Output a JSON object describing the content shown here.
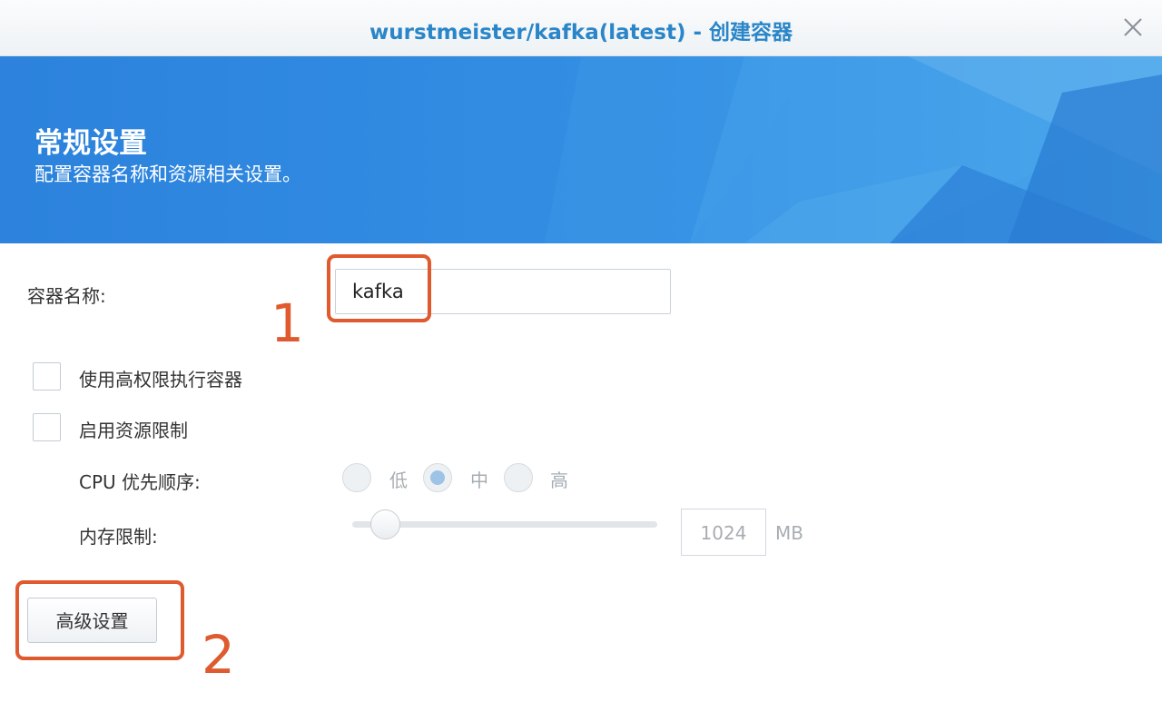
{
  "window": {
    "title": "wurstmeister/kafka(latest) - 创建容器",
    "close_icon": "close-icon"
  },
  "banner": {
    "title": "常规设置",
    "subtitle": "配置容器名称和资源相关设置。"
  },
  "form": {
    "container_name_label": "容器名称:",
    "container_name_value": "kafka",
    "privileged_label": "使用高权限执行容器",
    "privileged_checked": false,
    "resource_limit_label": "启用资源限制",
    "resource_limit_checked": false,
    "cpu_priority_label": "CPU 优先顺序:",
    "cpu_options": [
      "低",
      "中",
      "高"
    ],
    "cpu_selected": "中",
    "memory_limit_label": "内存限制:",
    "memory_value": "1024",
    "memory_unit": "MB",
    "advanced_button": "高级设置"
  },
  "annotations": {
    "marker_1": "1",
    "marker_2": "2",
    "color": "#df5a2e"
  },
  "colors": {
    "title_text": "#2a86c8",
    "banner_bg": "#2f8ae1",
    "disabled_text": "#a7adb2"
  }
}
